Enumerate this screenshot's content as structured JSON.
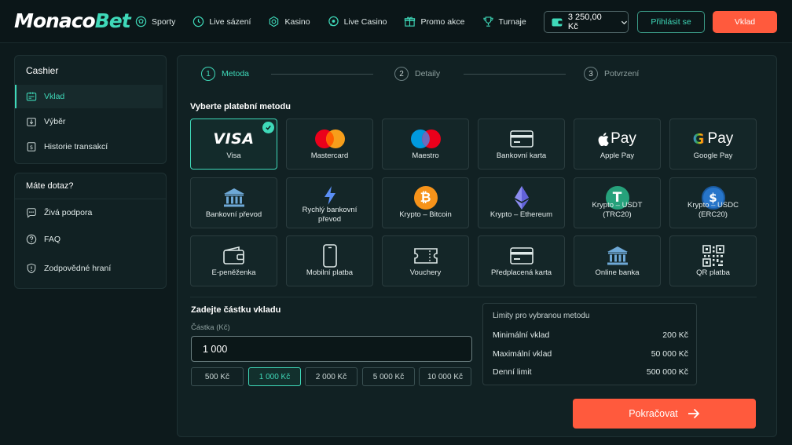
{
  "brand": {
    "name_a": "Monaco",
    "name_b": "Bet"
  },
  "nav": [
    {
      "label": "Sporty",
      "icon": "soccer-ball-icon"
    },
    {
      "label": "Live sázení",
      "icon": "live-clock-icon"
    },
    {
      "label": "Kasino",
      "icon": "casino-chip-icon"
    },
    {
      "label": "Live Casino",
      "icon": "live-chat-icon"
    },
    {
      "label": "Promo akce",
      "icon": "gift-icon"
    },
    {
      "label": "Turnaje",
      "icon": "trophy-icon"
    }
  ],
  "header": {
    "balance": "3 250,00 Kč",
    "login": "Přihlásit se",
    "deposit": "Vklad"
  },
  "sidebar": {
    "cashier_title": "Cashier",
    "items": [
      {
        "label": "Vklad",
        "icon": "deposit-icon"
      },
      {
        "label": "Výběr",
        "icon": "withdraw-icon"
      },
      {
        "label": "Historie transakcí",
        "icon": "history-icon"
      }
    ],
    "help_title": "Máte dotaz?",
    "help_items": [
      {
        "label": "Živá podpora",
        "icon": "chat-icon"
      },
      {
        "label": "FAQ",
        "icon": "question-icon"
      },
      {
        "label": "Zodpovědné hraní",
        "icon": "shield-icon"
      }
    ]
  },
  "steps": [
    {
      "num": "1",
      "label": "Metoda"
    },
    {
      "num": "2",
      "label": "Detaily"
    },
    {
      "num": "3",
      "label": "Potvrzení"
    }
  ],
  "methods_title": "Vyberte platební metodu",
  "methods": [
    {
      "label": "Visa",
      "logo_text": "VISA"
    },
    {
      "label": "Mastercard"
    },
    {
      "label": "Maestro"
    },
    {
      "label": "Bankovní karta"
    },
    {
      "label": "Apple Pay",
      "logo_text": "Pay"
    },
    {
      "label": "Google Pay",
      "logo_text": "Pay",
      "logo_g": "G"
    },
    {
      "label": "Bankovní převod"
    },
    {
      "label": "Rychlý bankovní převod"
    },
    {
      "label": "Krypto – Bitcoin",
      "logo_text": "₿"
    },
    {
      "label": "Krypto – Ethereum"
    },
    {
      "label": "Krypto – USDT (TRC20)",
      "logo_text": "T"
    },
    {
      "label": "Krypto – USDC (ERC20)",
      "logo_text": "$"
    },
    {
      "label": "E-peněženka"
    },
    {
      "label": "Mobilní platba"
    },
    {
      "label": "Vouchery"
    },
    {
      "label": "Předplacená karta"
    },
    {
      "label": "Online banka"
    },
    {
      "label": "QR platba"
    }
  ],
  "amount": {
    "title": "Zadejte částku vkladu",
    "field_label": "Částka (Kč)",
    "value": "1 000",
    "chips": [
      "500 Kč",
      "1 000 Kč",
      "2 000 Kč",
      "5 000 Kč",
      "10 000 Kč"
    ]
  },
  "limits": {
    "title": "Limity pro vybranou metodu",
    "rows": [
      {
        "label": "Minimální vklad",
        "value": "200 Kč"
      },
      {
        "label": "Maximální vklad",
        "value": "50 000 Kč"
      },
      {
        "label": "Denní limit",
        "value": "500 000 Kč"
      }
    ]
  },
  "continue_label": "Pokračovat",
  "colors": {
    "accent": "#3fd9b9",
    "cta": "#ff5a3d",
    "background": "#0d1a1c"
  }
}
